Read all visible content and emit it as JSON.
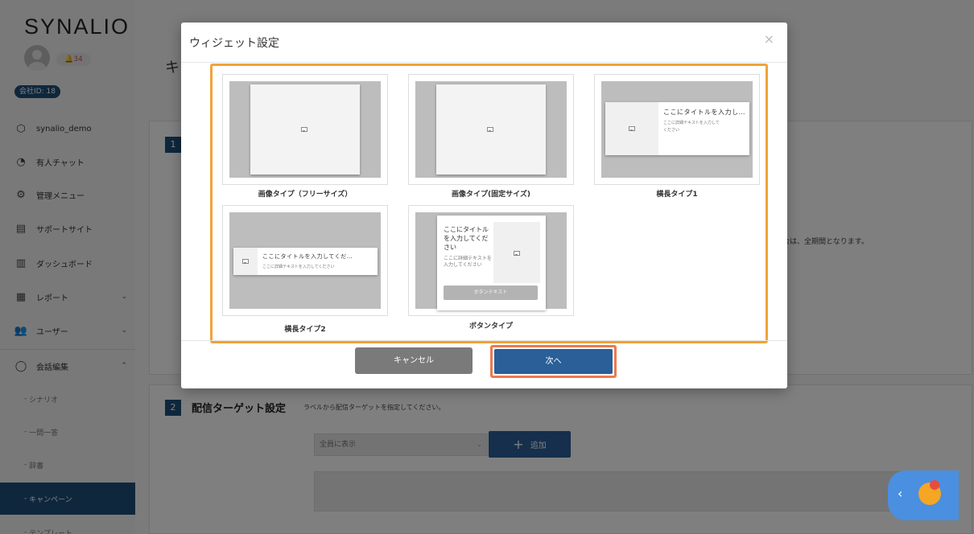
{
  "app": {
    "logo": "SYNALIO",
    "notification_count": "34",
    "company_id": "会社ID: 18"
  },
  "sidebar": {
    "items": [
      {
        "label": "synalio_demo",
        "icon": "cube-icon"
      },
      {
        "label": "有人チャット",
        "icon": "headset-icon"
      },
      {
        "label": "管理メニュー",
        "icon": "gears-icon"
      },
      {
        "label": "サポートサイト",
        "icon": "window-icon"
      },
      {
        "label": "ダッシュボード",
        "icon": "bar-chart-icon"
      },
      {
        "label": "レポート",
        "icon": "table-icon"
      },
      {
        "label": "ユーザー",
        "icon": "users-icon"
      },
      {
        "label": "会話編集",
        "icon": "chat-bubble-icon"
      }
    ],
    "sub_items": [
      {
        "label": "シナリオ"
      },
      {
        "label": "一問一答"
      },
      {
        "label": "辞書"
      },
      {
        "label": "キャンペーン"
      },
      {
        "label": "テンプレート"
      }
    ]
  },
  "main": {
    "page_title": "キ",
    "step1_number": "1",
    "step1_note": "合は、全期間となります。",
    "step2_number": "2",
    "step2_title": "配信ターゲット設定",
    "step2_desc": "ラベルから配信ターゲットを指定してください。",
    "target_select_value": "全員に表示",
    "add_button_label": "追加"
  },
  "modal": {
    "title": "ウィジェット設定",
    "close": "×",
    "options": [
      {
        "label": "画像タイプ（フリーサイズ）"
      },
      {
        "label": "画像タイプ(固定サイズ)"
      },
      {
        "label": "横長タイプ1"
      },
      {
        "label": "横長タイプ2"
      },
      {
        "label": "ボタンタイプ"
      }
    ],
    "preview": {
      "banner_title": "ここにタイトルを入力し…",
      "banner_subtitle_line1": "ここに詳細テキストを入力して",
      "banner_subtitle_line2": "ください",
      "banner2_title": "ここにタイトルを入力してくだ…",
      "banner2_subtitle": "ここに詳細テキストを入力してください",
      "button_card_title": "ここにタイトルを入力してください",
      "button_card_subtitle": "ここに詳細テキストを入力してください",
      "button_card_button": "ボタンテキスト"
    },
    "cancel_label": "キャンセル",
    "next_label": "次へ"
  },
  "colors": {
    "primary": "#2a5f98",
    "highlight_body": "#f0a33a",
    "highlight_next": "#ea7a4d",
    "sidebar_active": "#1f4e79"
  }
}
